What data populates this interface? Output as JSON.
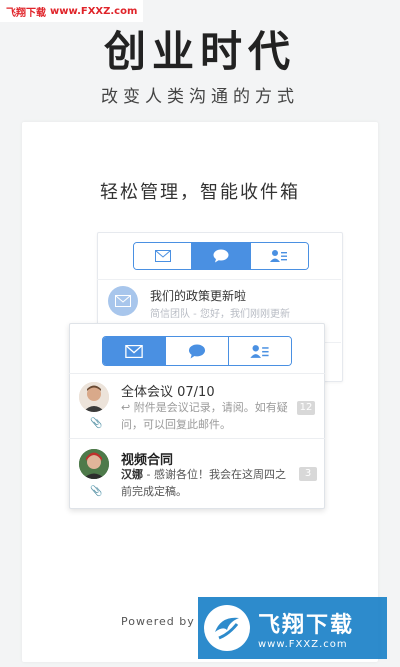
{
  "watermark_top": {
    "brand": "飞翔下载",
    "url": "www.FXXZ.com"
  },
  "hero": {
    "title": "创业时代",
    "subtitle": "改变人类沟通的方式"
  },
  "card": {
    "headline": "轻松管理，智能收件箱"
  },
  "back_panel": {
    "tabs": [
      {
        "icon": "mail-icon",
        "active": false
      },
      {
        "icon": "chat-bubble-icon",
        "active": true
      },
      {
        "icon": "contacts-icon",
        "active": false
      }
    ],
    "message": {
      "title": "我们的政策更新啦",
      "preview": "简信团队 - 您好，我们刚刚更新"
    }
  },
  "front_panel": {
    "tabs": [
      {
        "icon": "mail-icon",
        "active": true
      },
      {
        "icon": "chat-bubble-icon",
        "active": false
      },
      {
        "icon": "contacts-icon",
        "active": false
      }
    ],
    "messages": [
      {
        "title": "全体会议 07/10",
        "preview": "附件是会议记录，请阅。如有疑问，可以回复此邮件。",
        "count": "12"
      },
      {
        "title": "视频合同",
        "sender": "汉娜",
        "preview": " - 感谢各位！我会在这周四之前完成定稿。",
        "count": "3"
      }
    ]
  },
  "footer": {
    "powered": "Powered by"
  },
  "watermark_bottom": {
    "brand": "飞翔下载",
    "url": "www.FXXZ.com"
  },
  "colors": {
    "accent": "#4a90e2",
    "watermark": "#1c82c8",
    "watermark_top": "#e0242a"
  }
}
